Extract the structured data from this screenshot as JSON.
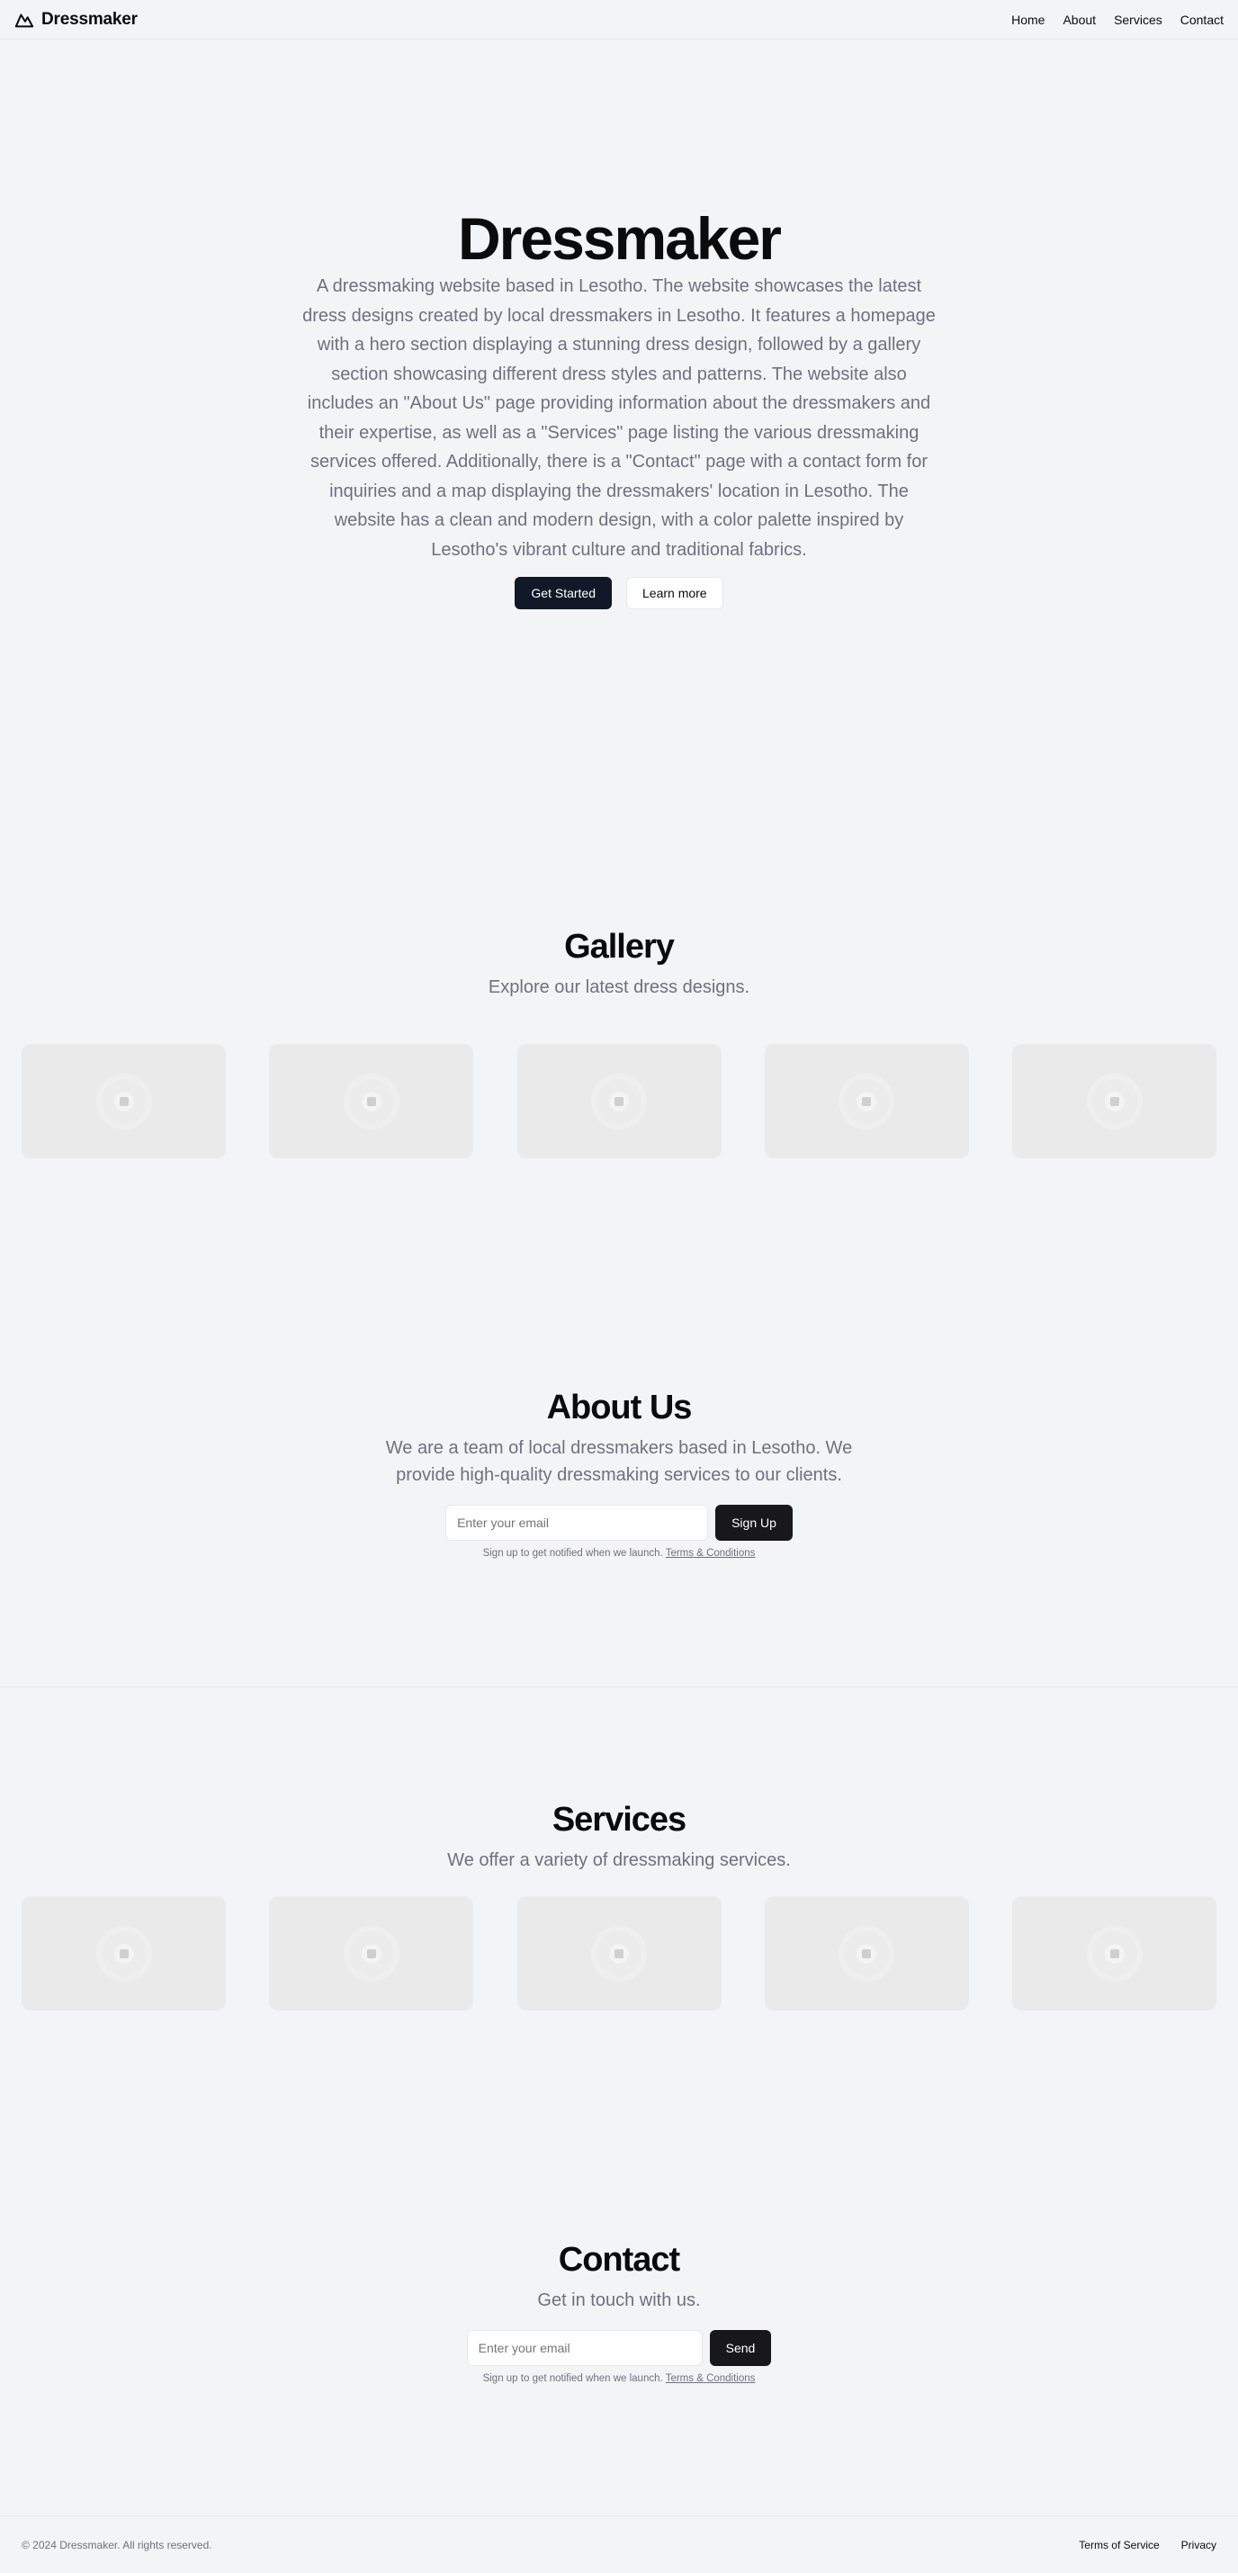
{
  "header": {
    "brand": "Dressmaker",
    "brand_icon": "mountain-icon",
    "nav": [
      "Home",
      "About",
      "Services",
      "Contact"
    ]
  },
  "hero": {
    "title": "Dressmaker",
    "description": "A dressmaking website based in Lesotho. The website showcases the latest dress designs created by local dressmakers in Lesotho. It features a homepage with a hero section displaying a stunning dress design, followed by a gallery section showcasing different dress styles and patterns. The website also includes an \"About Us\" page providing information about the dressmakers and their expertise, as well as a \"Services\" page listing the various dressmaking services offered. Additionally, there is a \"Contact\" page with a contact form for inquiries and a map displaying the dressmakers' location in Lesotho. The website has a clean and modern design, with a color palette inspired by Lesotho's vibrant culture and traditional fabrics.",
    "primary_button": "Get Started",
    "secondary_button": "Learn more"
  },
  "gallery": {
    "title": "Gallery",
    "subtitle": "Explore our latest dress designs.",
    "card_icon": "image-placeholder-icon"
  },
  "about": {
    "title": "About Us",
    "subtitle": "We are a team of local dressmakers based in Lesotho. We provide high-quality dressmaking services to our clients.",
    "email_placeholder": "Enter your email",
    "button": "Sign Up",
    "fine_print": "Sign up to get notified when we launch.",
    "terms_link": "Terms & Conditions"
  },
  "services": {
    "title": "Services",
    "subtitle": "We offer a variety of dressmaking services.",
    "card_icon": "image-placeholder-icon"
  },
  "contact": {
    "title": "Contact",
    "subtitle": "Get in touch with us.",
    "email_placeholder": "Enter your email",
    "button": "Send",
    "fine_print": "Sign up to get notified when we launch.",
    "terms_link": "Terms & Conditions"
  },
  "footer": {
    "copyright": "© 2024 Dressmaker. All rights reserved.",
    "links": [
      "Terms of Service",
      "Privacy"
    ]
  },
  "colors": {
    "background": "#f3f4f6",
    "primary_button": "#111827",
    "muted_text": "#6b7280",
    "card": "#eaeaea"
  }
}
